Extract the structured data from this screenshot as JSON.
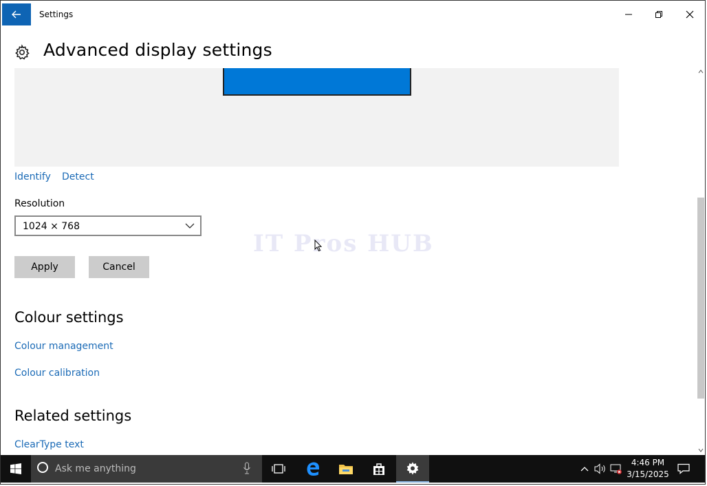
{
  "window": {
    "title": "Settings"
  },
  "header": {
    "title": "Advanced display settings"
  },
  "display": {
    "identify_label": "Identify",
    "detect_label": "Detect"
  },
  "resolution": {
    "label": "Resolution",
    "value": "1024 × 768"
  },
  "actions": {
    "apply_label": "Apply",
    "cancel_label": "Cancel"
  },
  "colour": {
    "heading": "Colour settings",
    "links": [
      "Colour management",
      "Colour calibration"
    ]
  },
  "related": {
    "heading": "Related settings",
    "links": [
      "ClearType text"
    ]
  },
  "watermark": "IT Pros HUB",
  "taskbar": {
    "search_placeholder": "Ask me anything",
    "time": "4:46 PM",
    "date": "3/15/2025"
  },
  "colors": {
    "accent": "#0e64b4",
    "monitor": "#0078d7",
    "link": "#1a6ab6",
    "taskbar": "#101010"
  },
  "icons": [
    "back-arrow-icon",
    "minimize-icon",
    "maximize-icon",
    "close-icon",
    "gear-icon",
    "chevron-down-icon",
    "windows-logo-icon",
    "cortana-icon",
    "microphone-icon",
    "task-view-icon",
    "edge-icon",
    "file-explorer-icon",
    "store-icon",
    "settings-gear-icon",
    "chevron-up-icon",
    "volume-icon",
    "network-icon",
    "action-center-icon"
  ]
}
